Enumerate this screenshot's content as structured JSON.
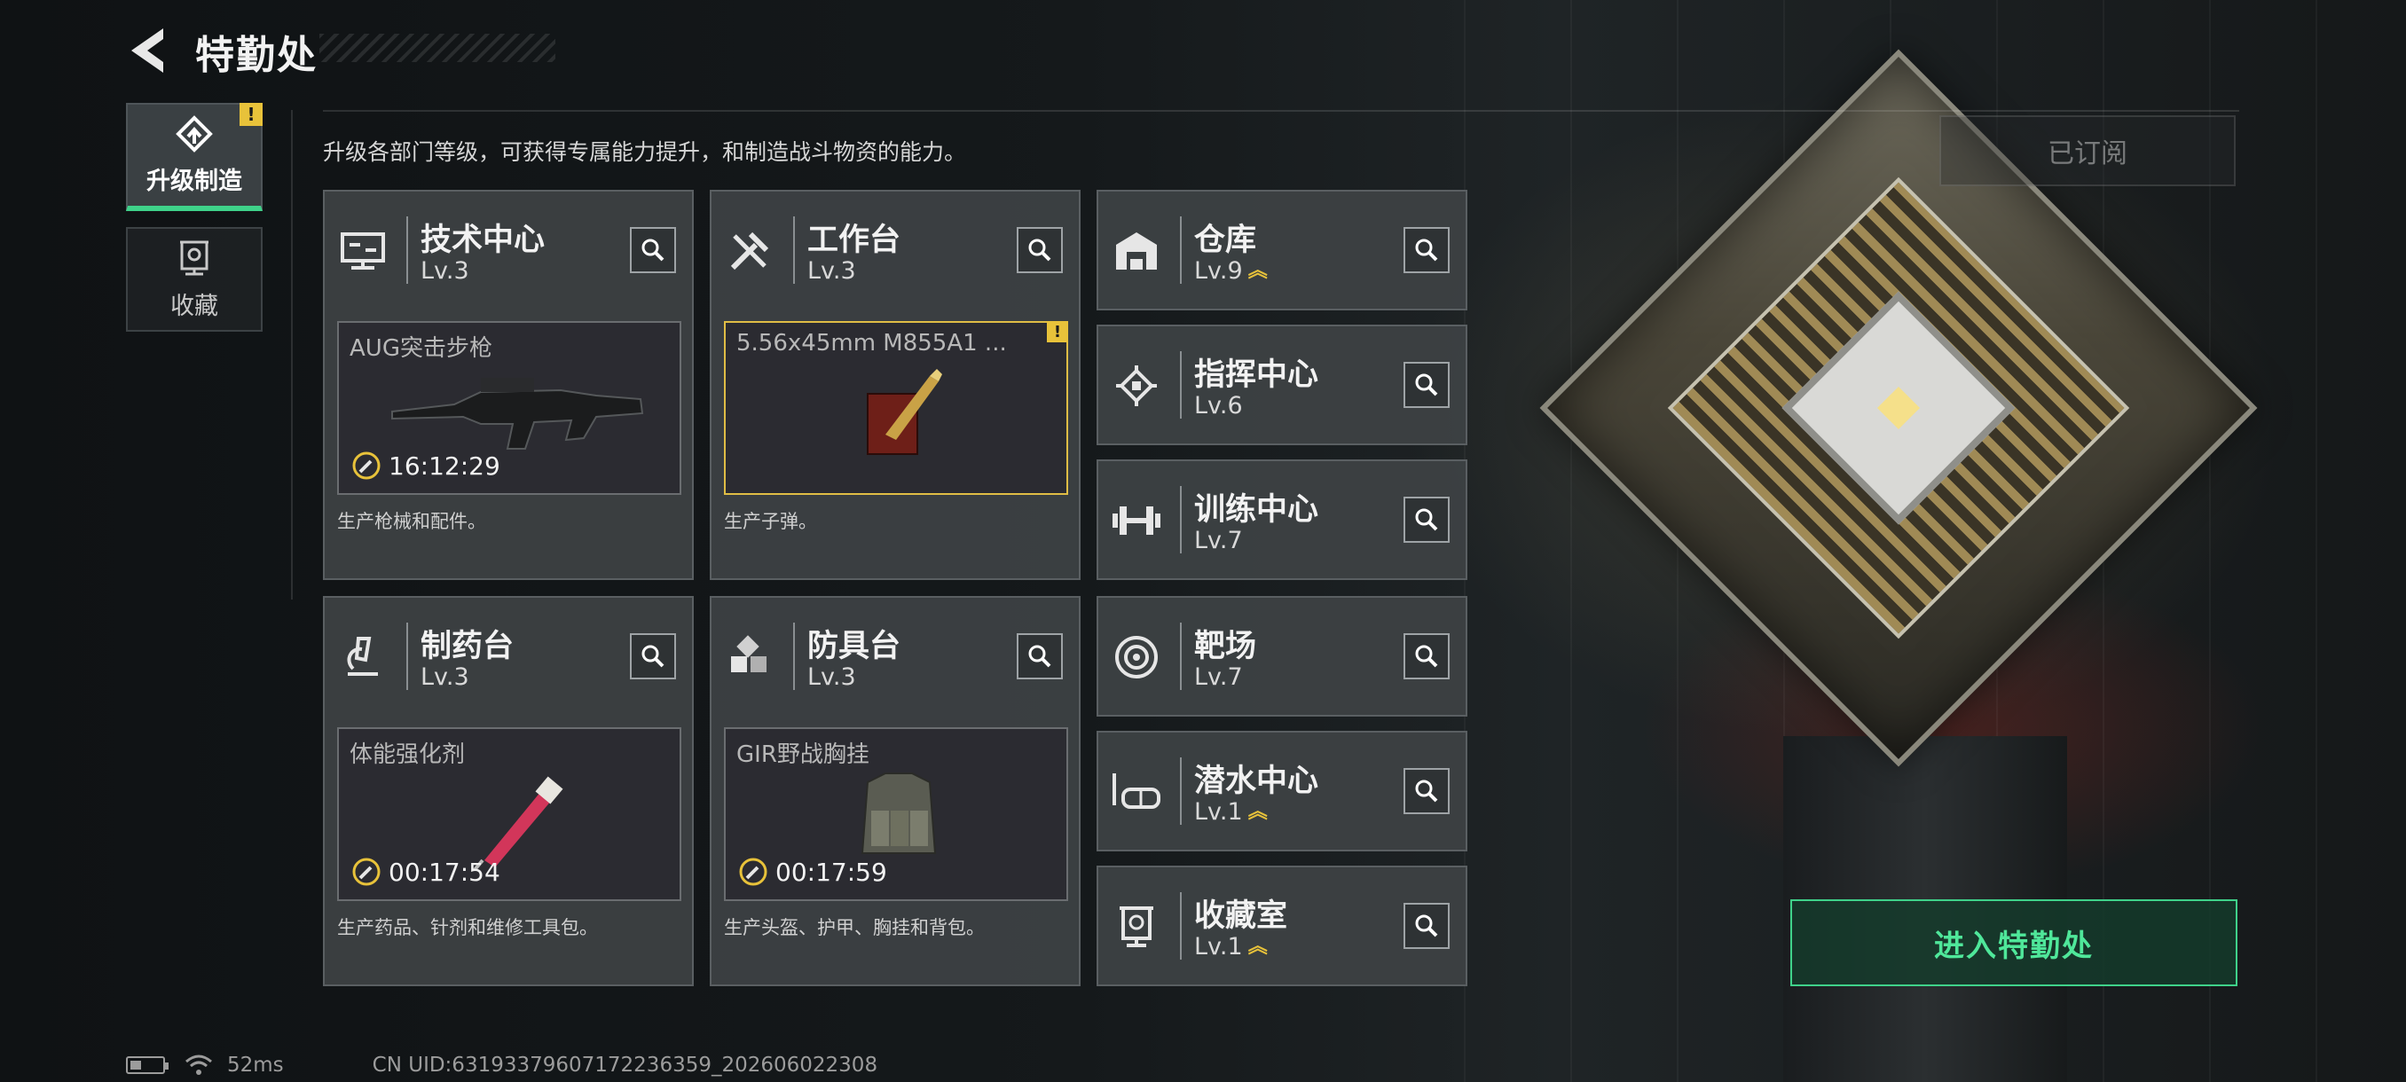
{
  "header": {
    "title": "特勤处"
  },
  "tabs": [
    {
      "label": "升级制造",
      "active": true,
      "alert": "!"
    },
    {
      "label": "收藏",
      "active": false
    }
  ],
  "description": "升级各部门等级，可获得专属能力提升，和制造战斗物资的能力。",
  "subscribe_label": "已订阅",
  "departments": {
    "tech_center": {
      "name": "技术中心",
      "level": "Lv.3",
      "icon": "monitor-icon",
      "product": {
        "name": "AUG突击步枪",
        "timer": "16:12:29"
      },
      "desc": "生产枪械和配件。"
    },
    "workbench": {
      "name": "工作台",
      "level": "Lv.3",
      "icon": "hammer-wrench-icon",
      "product": {
        "name": "5.56x45mm M855A1 ...",
        "alert": "!"
      },
      "desc": "生产子弹。"
    },
    "pharmacy": {
      "name": "制药台",
      "level": "Lv.3",
      "icon": "microscope-icon",
      "product": {
        "name": "体能强化剂",
        "timer": "00:17:54"
      },
      "desc": "生产药品、针剂和维修工具包。"
    },
    "armor_bench": {
      "name": "防具台",
      "level": "Lv.3",
      "icon": "cubes-icon",
      "product": {
        "name": "GIR野战胸挂",
        "timer": "00:17:59"
      },
      "desc": "生产头盔、护甲、胸挂和背包。"
    },
    "warehouse": {
      "name": "仓库",
      "level": "Lv.9",
      "icon": "warehouse-icon",
      "upgradable": true
    },
    "command_center": {
      "name": "指挥中心",
      "level": "Lv.6",
      "icon": "chip-icon",
      "upgradable": false
    },
    "training_center": {
      "name": "训练中心",
      "level": "Lv.7",
      "icon": "dumbbell-icon",
      "upgradable": false
    },
    "shooting_range": {
      "name": "靶场",
      "level": "Lv.7",
      "icon": "target-icon",
      "upgradable": false
    },
    "diving_center": {
      "name": "潜水中心",
      "level": "Lv.1",
      "icon": "diving-mask-icon",
      "upgradable": true
    },
    "collection_room": {
      "name": "收藏室",
      "level": "Lv.1",
      "icon": "trophy-case-icon",
      "upgradable": true
    }
  },
  "enter_button": "进入特勤处",
  "status": {
    "ping": "52ms",
    "uid": "CN UID:63193379607172236359_202606022308"
  },
  "colors": {
    "accent": "#3fd28a",
    "alert": "#e8c23a",
    "card_bg": "#3e4244"
  }
}
